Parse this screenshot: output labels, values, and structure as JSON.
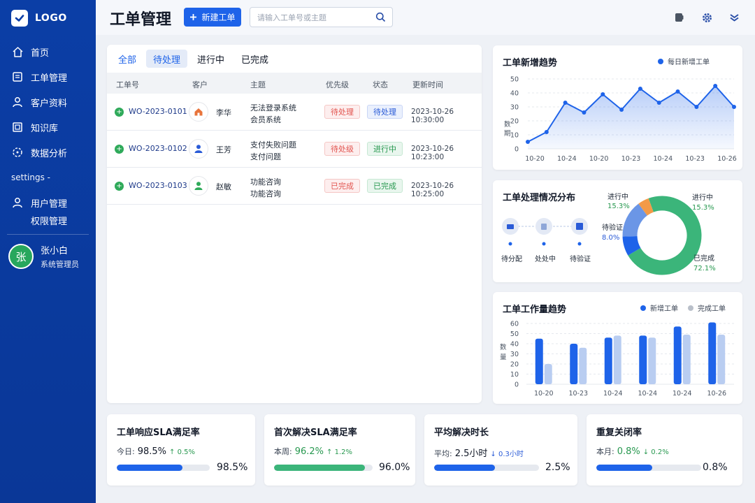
{
  "app": {
    "logo_text": "LOGO"
  },
  "sidebar": {
    "items": [
      {
        "label": "首页",
        "icon": "home-icon"
      },
      {
        "label": "工单管理",
        "icon": "ticket-icon"
      },
      {
        "label": "客户资料",
        "icon": "user-icon"
      },
      {
        "label": "知识库",
        "icon": "book-icon"
      },
      {
        "label": "数据分析",
        "icon": "chart-icon"
      }
    ],
    "section_label": "settings -",
    "settings_items": [
      {
        "label": "用户管理",
        "icon": "user-icon"
      },
      {
        "label": "权限管理"
      }
    ],
    "user": {
      "initial": "张",
      "name": "张小白",
      "role": "系统管理员"
    }
  },
  "header": {
    "title": "工单管理",
    "new_button": "新建工单",
    "search_placeholder": "请输入工单号或主题"
  },
  "tickets": {
    "tabs": [
      "全部",
      "待处理",
      "进行中",
      "已完成"
    ],
    "active_tab": "待处理",
    "columns": [
      "工单号",
      "客户",
      "主题",
      "优先级",
      "状态",
      "更新时间"
    ],
    "rows": [
      {
        "id": "WO-2023-0101",
        "customer": "李华",
        "subject_line1": "无法登录系统",
        "subject_line2": "会员系统",
        "priority": "待处理",
        "status": "待处理",
        "updated": "2023-10-26 10:30:00",
        "avatar_color": "#e8743b"
      },
      {
        "id": "WO-2023-0102",
        "customer": "王芳",
        "subject_line1": "支付失败问题",
        "subject_line2": "支付问题",
        "priority": "待处级",
        "status": "进行中",
        "updated": "2023-10-26 10:23:00",
        "avatar_color": "#2a5bd7"
      },
      {
        "id": "WO-2023-0103",
        "customer": "赵敏",
        "subject_line1": "功能咨询",
        "subject_line2": "功能咨询",
        "priority": "已完成",
        "status": "已完成",
        "updated": "2023-10-26 10:25:00",
        "avatar_color": "#2faa5a"
      }
    ]
  },
  "trend_card": {
    "title": "工单新增趋势",
    "legend": "每日新增工单"
  },
  "dist_card": {
    "title": "工单处理情况分布",
    "steps": [
      "待分配",
      "处处中",
      "待验证"
    ],
    "labels": [
      {
        "name": "进行中",
        "pct": "15.3%"
      },
      {
        "name": "进行中",
        "pct": "15.3%"
      },
      {
        "name": "待验证",
        "pct": "8.0%"
      },
      {
        "name": "已完成",
        "pct": "72.1%"
      }
    ]
  },
  "workload_card": {
    "title": "工单工作量趋势",
    "legend_new": "新增工单",
    "legend_done": "完成工单"
  },
  "kpis": [
    {
      "title": "工单响应SLA满足率",
      "period": "今日:",
      "value": "98.5%",
      "delta": "↑ 0.5%",
      "delta_dir": "up",
      "bar_label": "98.5%",
      "fill": 0.71,
      "color": "#1e63e9"
    },
    {
      "title": "首次解决SLA满足率",
      "period": "本周:",
      "value": "96.2%",
      "delta": "↑ 1.2%",
      "delta_dir": "up",
      "bar_label": "96.0%",
      "fill": 0.92,
      "color": "#3bb57a"
    },
    {
      "title": "平均解决时长",
      "period": "平均:",
      "value": "2.5小时",
      "delta": "↓ 0.3小时",
      "delta_dir": "down",
      "bar_label": "2.5%",
      "fill": 0.58,
      "color": "#1e63e9"
    },
    {
      "title": "重复关闭率",
      "period": "本月:",
      "value": "0.8%",
      "delta": "↓ 0.2%",
      "delta_dir": "down",
      "bar_label": "0.8%",
      "fill": 0.53,
      "color": "#1e63e9"
    }
  ],
  "chart_data": [
    {
      "type": "area",
      "title": "工单新增趋势",
      "ylabel": "数期",
      "ylim": [
        0,
        50
      ],
      "yticks": [
        0,
        10,
        20,
        30,
        40,
        50
      ],
      "xticks": [
        "10-20",
        "10-24",
        "10-20",
        "10-23",
        "10-24",
        "10-23",
        "10-26"
      ],
      "series": [
        {
          "name": "每日新增工单",
          "values": [
            5,
            12,
            33,
            26,
            39,
            28,
            43,
            33,
            41,
            30,
            45,
            30
          ]
        }
      ]
    },
    {
      "type": "pie",
      "title": "工单处理情况分布",
      "donut": true,
      "slices": [
        {
          "label": "已完成",
          "value": 72.1,
          "color": "#3bb57a"
        },
        {
          "label": "待验证",
          "value": 8.0,
          "color": "#1e63e9"
        },
        {
          "label": "进行中",
          "value": 15.3,
          "color": "#6b96e6"
        },
        {
          "label": "进行中",
          "value": 4.6,
          "color": "#f39a48"
        }
      ]
    },
    {
      "type": "bar",
      "title": "工单工作量趋势",
      "ylabel": "数量",
      "ylim": [
        0,
        60
      ],
      "yticks": [
        0,
        10,
        20,
        30,
        40,
        50,
        60
      ],
      "categories": [
        "10-20",
        "10-23",
        "10-24",
        "10-24",
        "10-24",
        "10-26"
      ],
      "series": [
        {
          "name": "新增工单",
          "values": [
            45,
            40,
            46,
            48,
            57,
            61
          ],
          "color": "#1e63e9"
        },
        {
          "name": "完成工单",
          "values": [
            20,
            36,
            48,
            46,
            49,
            49
          ],
          "color": "#b9cdf1"
        }
      ]
    }
  ]
}
